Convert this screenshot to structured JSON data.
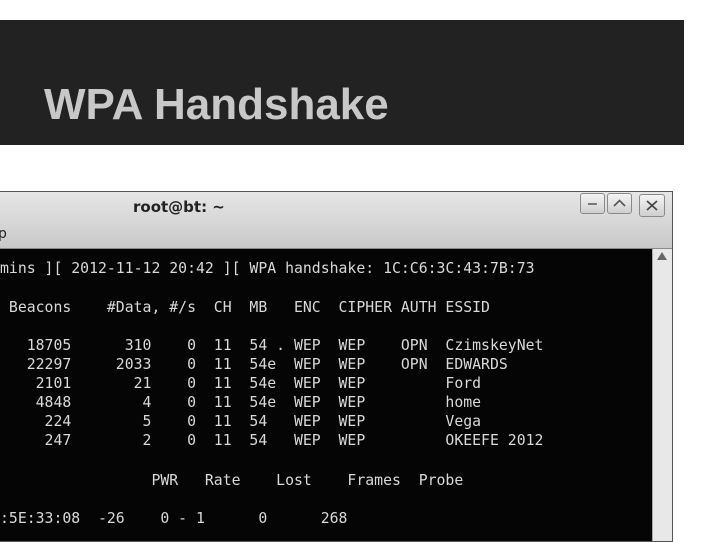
{
  "slide": {
    "title": "WPA Handshake"
  },
  "window": {
    "title": "root@bt: ~",
    "menu_stub": "p",
    "buttons": {
      "minimize": "minimize",
      "maximize": "maximize",
      "close": "close"
    }
  },
  "terminal": {
    "status_line": "mins ][ 2012-11-12 20:42 ][ WPA handshake: 1C:C6:3C:43:7B:73",
    "ap_header": " Beacons    #Data, #/s  CH  MB   ENC  CIPHER AUTH ESSID",
    "ap_rows": [
      "   18705      310    0  11  54 . WEP  WEP    OPN  CzimskeyNet",
      "   22297     2033    0  11  54e  WEP  WEP    OPN  EDWARDS",
      "    2101       21    0  11  54e  WEP  WEP         Ford",
      "    4848        4    0  11  54e  WEP  WEP         home",
      "     224        5    0  11  54   WEP  WEP         Vega",
      "     247        2    0  11  54   WEP  WEP         OKEEFE 2012"
    ],
    "station_header": "                 PWR   Rate    Lost    Frames  Probe",
    "station_rows": [
      ":5E:33:08  -26    0 - 1      0      268"
    ]
  },
  "colors": {
    "title_bar": "#222222",
    "title_text": "#c8c8c8",
    "terminal_bg": "#050505",
    "terminal_text": "#d8d8d8"
  }
}
